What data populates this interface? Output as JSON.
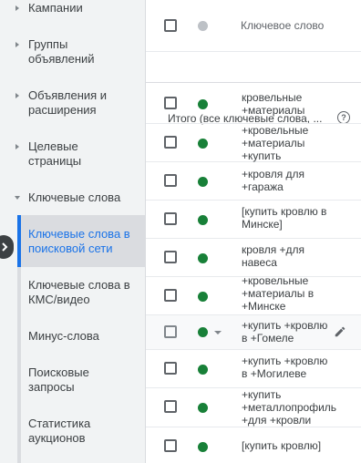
{
  "sidebar": {
    "items": [
      {
        "label": "Кампании"
      },
      {
        "label": "Группы\nобъявлений"
      },
      {
        "label": "Объявления и\nрасширения"
      },
      {
        "label": "Целевые\nстраницы"
      },
      {
        "label": "Ключевые слова"
      }
    ],
    "subitems": [
      {
        "label": "Ключевые слова в\nпоисковой сети"
      },
      {
        "label": "Ключевые слова в\nКМС/видео"
      },
      {
        "label": "Минус-слова"
      },
      {
        "label": "Поисковые\nзапросы"
      },
      {
        "label": "Статистика\nаукционов"
      }
    ]
  },
  "table": {
    "header": {
      "keyword_label": "Ключевое слово"
    },
    "total": {
      "label": "Итого (все ключевые слова, ...",
      "help": "?"
    },
    "rows": [
      {
        "keyword": "кровельные\n+материалы",
        "status": "enabled"
      },
      {
        "keyword": "+кровельные\n+материалы\n+купить",
        "status": "enabled"
      },
      {
        "keyword": "+кровля для\n+гаража",
        "status": "enabled"
      },
      {
        "keyword": "[купить кровлю в\nМинске]",
        "status": "enabled"
      },
      {
        "keyword": "кровля +для\nнавеса",
        "status": "enabled"
      },
      {
        "keyword": "+кровельные\n+материалы в\n+Минске",
        "status": "enabled"
      },
      {
        "keyword": "+купить +кровлю\nв +Гомеле",
        "status": "enabled"
      },
      {
        "keyword": "+купить +кровлю\nв +Могилеве",
        "status": "enabled"
      },
      {
        "keyword": "+купить\n+металлопрофиль\n+для +кровли",
        "status": "enabled"
      },
      {
        "keyword": "[купить кровлю]",
        "status": "enabled"
      }
    ]
  },
  "colors": {
    "status_enabled": "#188038",
    "accent": "#1a73e8"
  },
  "icons": {
    "help": "help-icon",
    "edit": "pencil-icon",
    "collapse": "chevron-right-icon"
  }
}
